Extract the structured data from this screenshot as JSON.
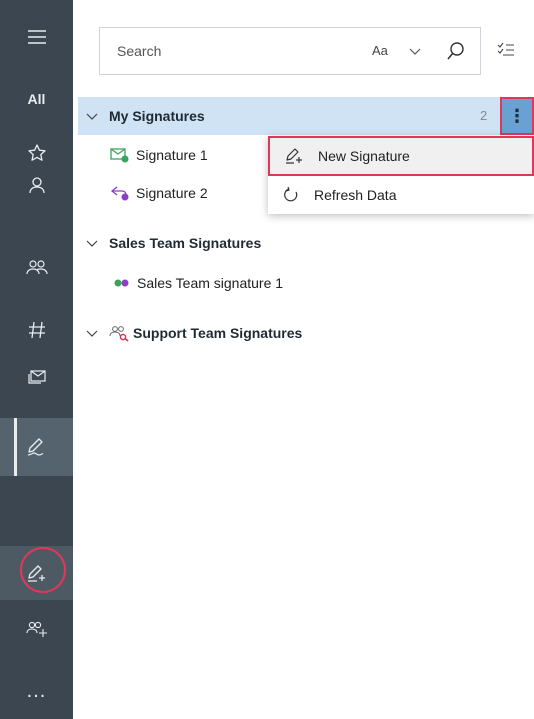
{
  "rail": {
    "all_label": "All",
    "more_label": "..."
  },
  "search": {
    "placeholder": "Search",
    "case_label": "Aa"
  },
  "groups": [
    {
      "label": "My Signatures",
      "count": "2",
      "items": [
        "Signature 1",
        "Signature 2"
      ]
    },
    {
      "label": "Sales Team Signatures",
      "items": [
        "Sales Team signature 1"
      ]
    },
    {
      "label": "Support Team Signatures",
      "items": []
    }
  ],
  "menu": {
    "items": [
      "New Signature",
      "Refresh Data"
    ]
  },
  "colors": {
    "rail_bg": "#3b4650",
    "selection_bg": "#cfe3f4",
    "highlight_border": "#e0385a",
    "more_button_bg": "#6aa1d3",
    "green_icon": "#3aa35a",
    "purple_icon": "#8b3fc7"
  },
  "icons": [
    "hamburger-icon",
    "star-icon",
    "person-icon",
    "people-icon",
    "hashtag-icon",
    "mail-stack-icon",
    "signature-pen-icon",
    "new-signature-icon",
    "add-people-icon",
    "search-icon",
    "chevron-down-icon",
    "filter-checklist-icon",
    "more-vertical-icon",
    "refresh-icon"
  ]
}
